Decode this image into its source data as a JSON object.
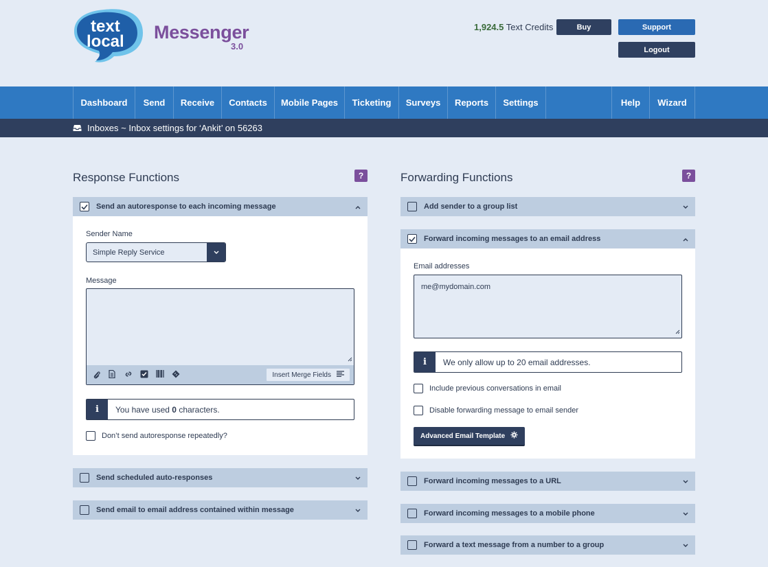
{
  "logo": {
    "line1": "text",
    "line2": "local"
  },
  "brand": {
    "name": "Messenger",
    "version": "3.0"
  },
  "header": {
    "credits_value": "1,924.5",
    "credits_label": " Text Credits",
    "buy": "Buy",
    "support": "Support",
    "logout": "Logout"
  },
  "nav": {
    "items": [
      "Dashboard",
      "Send",
      "Receive",
      "Contacts",
      "Mobile Pages",
      "Ticketing",
      "Surveys",
      "Reports",
      "Settings",
      "Help",
      "Wizard"
    ]
  },
  "breadcrumb": {
    "text": "Inboxes ~ Inbox settings for ‘Ankit’ on  56263"
  },
  "response": {
    "title": "Response Functions",
    "help": "?",
    "autoresponse": {
      "label": "Send an autoresponse to each incoming message",
      "checked": true,
      "sender_label": "Sender Name",
      "sender_value": "Simple Reply Service",
      "message_label": "Message",
      "message_value": "",
      "merge_button": "Insert Merge Fields",
      "chars_prefix": "You have used ",
      "chars_count": "0",
      "chars_suffix": " characters.",
      "repeat_label": "Don’t send autoresponse repeatedly?"
    },
    "scheduled": {
      "label": "Send scheduled auto-responses"
    },
    "email_within": {
      "label": "Send email to email address contained within message"
    }
  },
  "forwarding": {
    "title": "Forwarding Functions",
    "help": "?",
    "group_list": {
      "label": "Add sender to a group list"
    },
    "email": {
      "label": "Forward incoming messages to an email address",
      "checked": true,
      "addresses_label": "Email addresses",
      "addresses_value": "me@mydomain.com",
      "info": "We only allow up to 20 email addresses.",
      "include_prev": "Include previous conversations in email",
      "disable_fwd": "Disable forwarding message to email sender",
      "advanced_button": "Advanced Email Template"
    },
    "url": {
      "label": "Forward incoming messages to a URL"
    },
    "mobile": {
      "label": "Forward incoming messages to a mobile phone"
    },
    "text_from_number": {
      "label": "Forward a text message from a number to a group"
    }
  },
  "colors": {
    "background": "#e4ebf5",
    "nav": "#2f79c2",
    "subbar": "#2f3f5e",
    "accordion": "#bdcde0",
    "brand_purple": "#7b4f9c",
    "logo_blue": "#1f5fa8",
    "credits_green": "#3a6b3a"
  },
  "icons": [
    "inbox-icon",
    "paperclip-icon",
    "document-icon",
    "link-icon",
    "checkbox-icon",
    "barcode-icon",
    "ticket-icon",
    "align-icon",
    "info-icon",
    "gear-icon",
    "chevron-up-icon",
    "chevron-down-icon",
    "resize-grip-icon"
  ]
}
